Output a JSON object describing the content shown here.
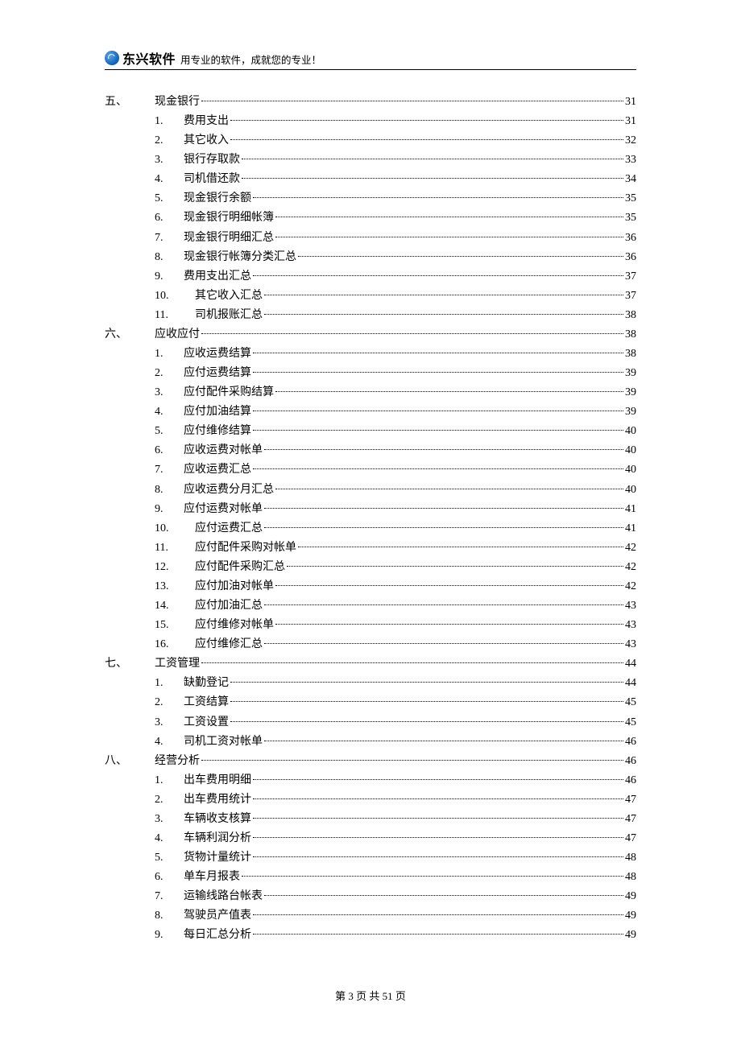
{
  "header": {
    "logo_text": "东兴软件",
    "slogan": "用专业的软件，成就您的专业！"
  },
  "footer": {
    "text": "第 3 页 共 51 页"
  },
  "toc": [
    {
      "num": "五、",
      "title": "现金银行",
      "page": "31",
      "items": [
        {
          "num": "1.",
          "title": "费用支出",
          "page": "31"
        },
        {
          "num": "2.",
          "title": "其它收入",
          "page": "32"
        },
        {
          "num": "3.",
          "title": "银行存取款",
          "page": "33"
        },
        {
          "num": "4.",
          "title": "司机借还款",
          "page": "34"
        },
        {
          "num": "5.",
          "title": "现金银行余额",
          "page": "35"
        },
        {
          "num": "6.",
          "title": "现金银行明细帐簿",
          "page": "35"
        },
        {
          "num": "7.",
          "title": "现金银行明细汇总",
          "page": "36"
        },
        {
          "num": "8.",
          "title": "现金银行帐簿分类汇总",
          "page": "36"
        },
        {
          "num": "9.",
          "title": "费用支出汇总",
          "page": "37"
        },
        {
          "num": "10.",
          "title": "其它收入汇总",
          "page": "37"
        },
        {
          "num": "11.",
          "title": "司机报账汇总",
          "page": "38"
        }
      ]
    },
    {
      "num": "六、",
      "title": "应收应付",
      "page": "38",
      "items": [
        {
          "num": "1.",
          "title": "应收运费结算",
          "page": "38"
        },
        {
          "num": "2.",
          "title": "应付运费结算",
          "page": "39"
        },
        {
          "num": "3.",
          "title": "应付配件采购结算",
          "page": "39"
        },
        {
          "num": "4.",
          "title": "应付加油结算",
          "page": "39"
        },
        {
          "num": "5.",
          "title": "应付维修结算",
          "page": "40"
        },
        {
          "num": "6.",
          "title": "应收运费对帐单",
          "page": "40"
        },
        {
          "num": "7.",
          "title": "应收运费汇总",
          "page": "40"
        },
        {
          "num": "8.",
          "title": "应收运费分月汇总",
          "page": "40"
        },
        {
          "num": "9.",
          "title": "应付运费对帐单",
          "page": "41"
        },
        {
          "num": "10.",
          "title": "应付运费汇总",
          "page": "41"
        },
        {
          "num": "11.",
          "title": "应付配件采购对帐单",
          "page": "42"
        },
        {
          "num": "12.",
          "title": "应付配件采购汇总",
          "page": "42"
        },
        {
          "num": "13.",
          "title": "应付加油对帐单",
          "page": "42"
        },
        {
          "num": "14.",
          "title": "应付加油汇总",
          "page": "43"
        },
        {
          "num": "15.",
          "title": "应付维修对帐单",
          "page": "43"
        },
        {
          "num": "16.",
          "title": "应付维修汇总",
          "page": "43"
        }
      ]
    },
    {
      "num": "七、",
      "title": "工资管理",
      "page": "44",
      "items": [
        {
          "num": "1.",
          "title": "缺勤登记",
          "page": "44"
        },
        {
          "num": "2.",
          "title": "工资结算",
          "page": "45"
        },
        {
          "num": "3.",
          "title": "工资设置",
          "page": "45"
        },
        {
          "num": "4.",
          "title": "司机工资对帐单",
          "page": "46"
        }
      ]
    },
    {
      "num": "八、",
      "title": "经营分析",
      "page": "46",
      "items": [
        {
          "num": "1.",
          "title": "出车费用明细",
          "page": "46"
        },
        {
          "num": "2.",
          "title": "出车费用统计",
          "page": "47"
        },
        {
          "num": "3.",
          "title": "车辆收支核算",
          "page": "47"
        },
        {
          "num": "4.",
          "title": "车辆利润分析",
          "page": "47"
        },
        {
          "num": "5.",
          "title": "货物计量统计",
          "page": "48"
        },
        {
          "num": "6.",
          "title": "单车月报表",
          "page": "48"
        },
        {
          "num": "7.",
          "title": "运输线路台帐表",
          "page": "49"
        },
        {
          "num": "8.",
          "title": "驾驶员产值表",
          "page": "49"
        },
        {
          "num": "9.",
          "title": "每日汇总分析",
          "page": "49"
        }
      ]
    }
  ]
}
